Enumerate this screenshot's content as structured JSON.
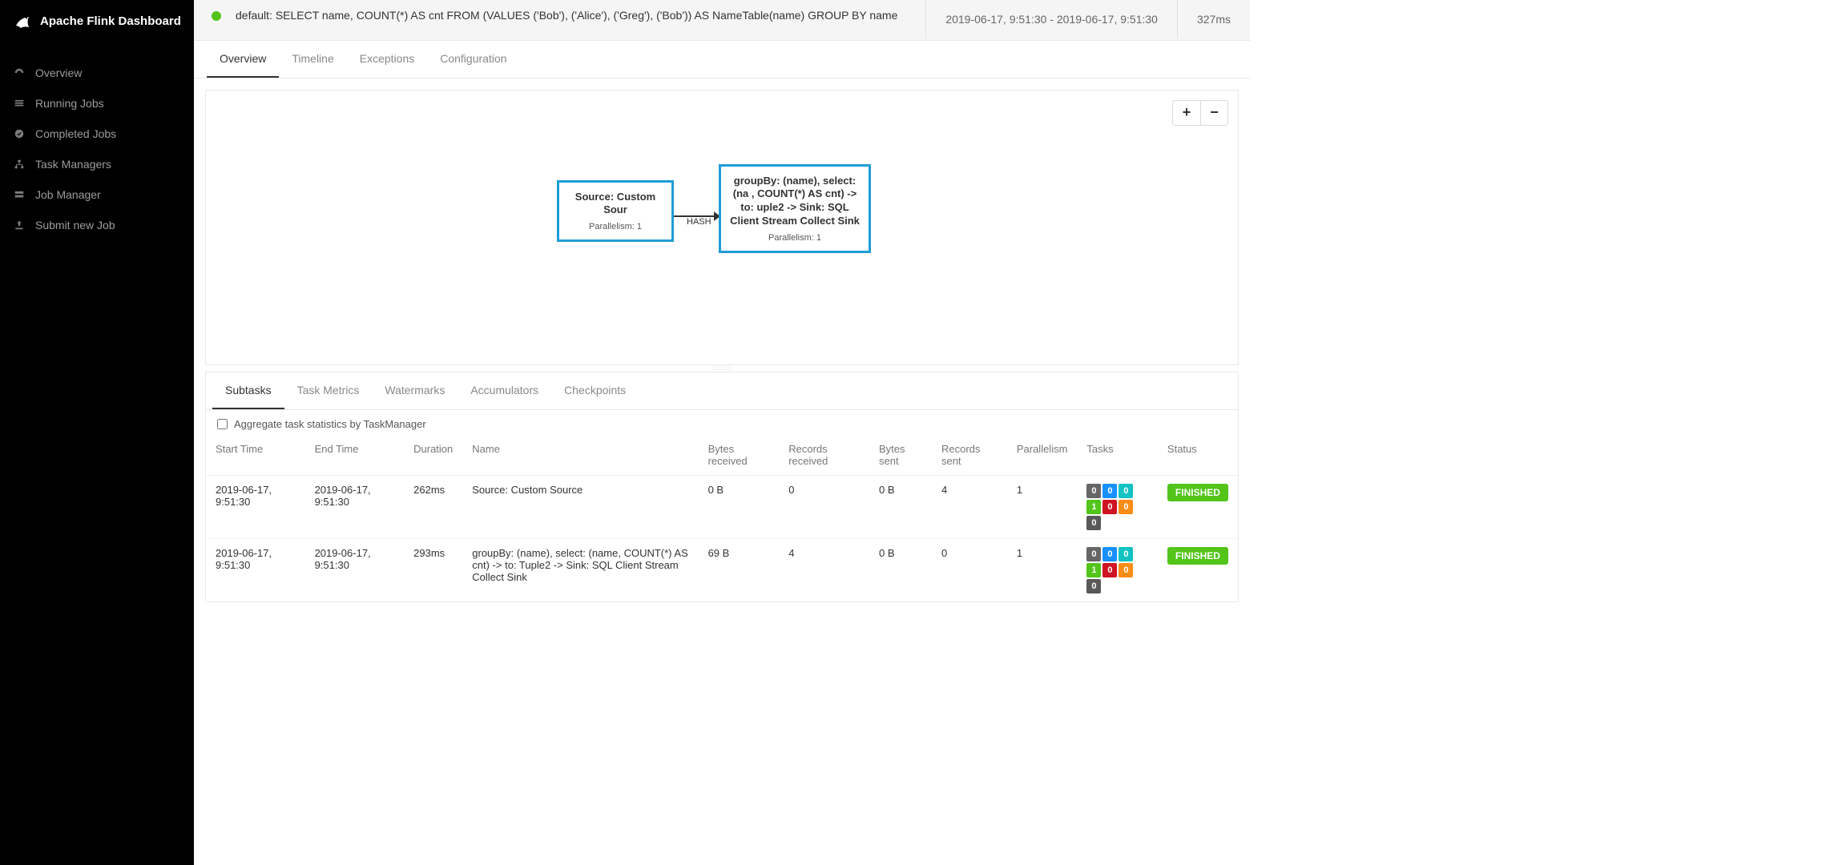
{
  "brand": "Apache Flink Dashboard",
  "nav": {
    "overview": "Overview",
    "running": "Running Jobs",
    "completed": "Completed Jobs",
    "task_managers": "Task Managers",
    "job_manager": "Job Manager",
    "submit": "Submit new Job"
  },
  "job": {
    "name": "default: SELECT name, COUNT(*) AS cnt FROM (VALUES ('Bob'), ('Alice'), ('Greg'), ('Bob')) AS NameTable(name) GROUP BY name",
    "time_range": "2019-06-17, 9:51:30 - 2019-06-17, 9:51:30",
    "duration": "327ms"
  },
  "tabs": {
    "overview": "Overview",
    "timeline": "Timeline",
    "exceptions": "Exceptions",
    "configuration": "Configuration"
  },
  "graph": {
    "node1": {
      "title": "Source: Custom Sour",
      "sub": "Parallelism: 1"
    },
    "edge_label": "HASH",
    "node2": {
      "title": "groupBy: (name), select: (na , COUNT(*) AS cnt) -> to: uple2 -> Sink: SQL Client Stream Collect Sink",
      "sub": "Parallelism: 1"
    },
    "zoom_in": "+",
    "zoom_out": "−"
  },
  "sub_tabs": {
    "subtasks": "Subtasks",
    "task_metrics": "Task Metrics",
    "watermarks": "Watermarks",
    "accumulators": "Accumulators",
    "checkpoints": "Checkpoints"
  },
  "aggregate_label": "Aggregate task statistics by TaskManager",
  "table": {
    "headers": {
      "start": "Start Time",
      "end": "End Time",
      "duration": "Duration",
      "name": "Name",
      "bytes_recv": "Bytes received",
      "records_recv": "Records received",
      "bytes_sent": "Bytes sent",
      "records_sent": "Records sent",
      "parallelism": "Parallelism",
      "tasks": "Tasks",
      "status": "Status"
    },
    "rows": [
      {
        "start": "2019-06-17, 9:51:30",
        "end": "2019-06-17, 9:51:30",
        "duration": "262ms",
        "name": "Source: Custom Source",
        "bytes_recv": "0 B",
        "records_recv": "0",
        "bytes_sent": "0 B",
        "records_sent": "4",
        "parallelism": "1",
        "tasks": [
          "0",
          "0",
          "0",
          "1",
          "0",
          "0",
          "0"
        ],
        "status": "FINISHED"
      },
      {
        "start": "2019-06-17, 9:51:30",
        "end": "2019-06-17, 9:51:30",
        "duration": "293ms",
        "name": "groupBy: (name), select: (name, COUNT(*) AS cnt) -> to: Tuple2 -> Sink: SQL Client Stream Collect Sink",
        "bytes_recv": "69 B",
        "records_recv": "4",
        "bytes_sent": "0 B",
        "records_sent": "0",
        "parallelism": "1",
        "tasks": [
          "0",
          "0",
          "0",
          "1",
          "0",
          "0",
          "0"
        ],
        "status": "FINISHED"
      }
    ]
  }
}
